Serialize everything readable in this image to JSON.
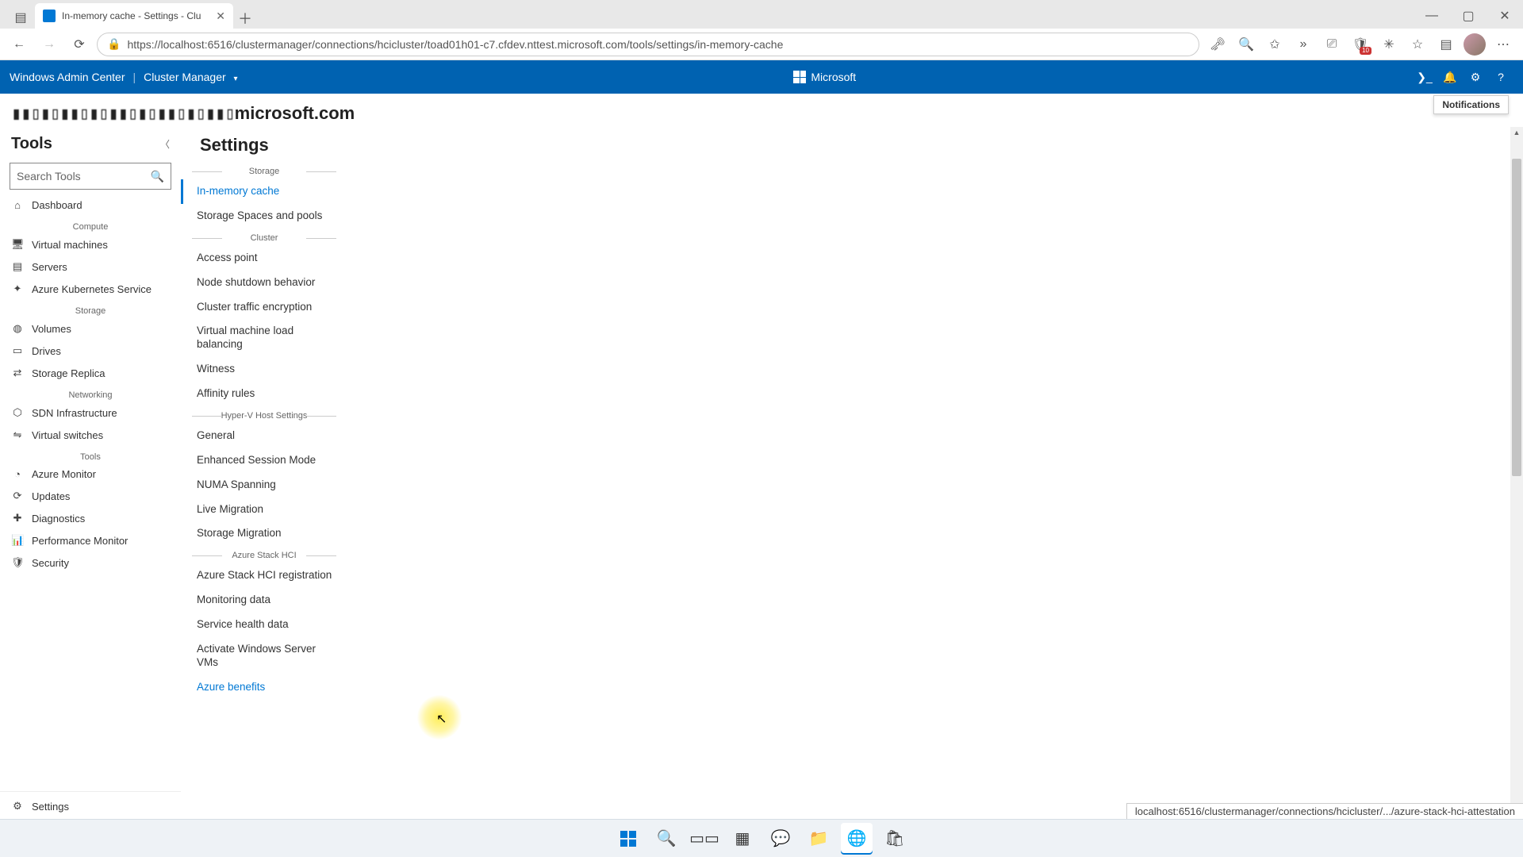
{
  "browser": {
    "tab_title": "In-memory cache - Settings - Clu",
    "url": "https://localhost:6516/clustermanager/connections/hcicluster/toad01h01-c7.cfdev.nttest.microsoft.com/tools/settings/in-memory-cache",
    "ext_badge": "10"
  },
  "wac_header": {
    "product": "Windows Admin Center",
    "context": "Cluster Manager",
    "brand": "Microsoft"
  },
  "notifications_tooltip": "Notifications",
  "cluster_name_suffix": "microsoft.com",
  "tools": {
    "title": "Tools",
    "search_placeholder": "Search Tools",
    "groups": [
      {
        "label": "",
        "items": [
          {
            "icon": "home",
            "label": "Dashboard"
          }
        ]
      },
      {
        "label": "Compute",
        "items": [
          {
            "icon": "vm",
            "label": "Virtual machines"
          },
          {
            "icon": "server",
            "label": "Servers"
          },
          {
            "icon": "aks",
            "label": "Azure Kubernetes Service"
          }
        ]
      },
      {
        "label": "Storage",
        "items": [
          {
            "icon": "volume",
            "label": "Volumes"
          },
          {
            "icon": "drive",
            "label": "Drives"
          },
          {
            "icon": "replica",
            "label": "Storage Replica"
          }
        ]
      },
      {
        "label": "Networking",
        "items": [
          {
            "icon": "sdn",
            "label": "SDN Infrastructure"
          },
          {
            "icon": "vswitch",
            "label": "Virtual switches"
          }
        ]
      },
      {
        "label": "Tools",
        "items": [
          {
            "icon": "monitor",
            "label": "Azure Monitor"
          },
          {
            "icon": "updates",
            "label": "Updates"
          },
          {
            "icon": "diag",
            "label": "Diagnostics"
          },
          {
            "icon": "perf",
            "label": "Performance Monitor"
          },
          {
            "icon": "security",
            "label": "Security"
          }
        ]
      }
    ],
    "settings_label": "Settings"
  },
  "settings": {
    "title": "Settings",
    "groups": [
      {
        "label": "Storage",
        "items": [
          {
            "label": "In-memory cache",
            "active": true
          },
          {
            "label": "Storage Spaces and pools"
          }
        ]
      },
      {
        "label": "Cluster",
        "items": [
          {
            "label": "Access point"
          },
          {
            "label": "Node shutdown behavior"
          },
          {
            "label": "Cluster traffic encryption"
          },
          {
            "label": "Virtual machine load balancing"
          },
          {
            "label": "Witness"
          },
          {
            "label": "Affinity rules"
          }
        ]
      },
      {
        "label": "Hyper-V Host Settings",
        "items": [
          {
            "label": "General"
          },
          {
            "label": "Enhanced Session Mode"
          },
          {
            "label": "NUMA Spanning"
          },
          {
            "label": "Live Migration"
          },
          {
            "label": "Storage Migration"
          }
        ]
      },
      {
        "label": "Azure Stack HCI",
        "items": [
          {
            "label": "Azure Stack HCI registration"
          },
          {
            "label": "Monitoring data"
          },
          {
            "label": "Service health data"
          },
          {
            "label": "Activate Windows Server VMs"
          },
          {
            "label": "Azure benefits",
            "hover": true
          }
        ]
      }
    ]
  },
  "status_url": "localhost:6516/clustermanager/connections/hcicluster/.../azure-stack-hci-attestation"
}
